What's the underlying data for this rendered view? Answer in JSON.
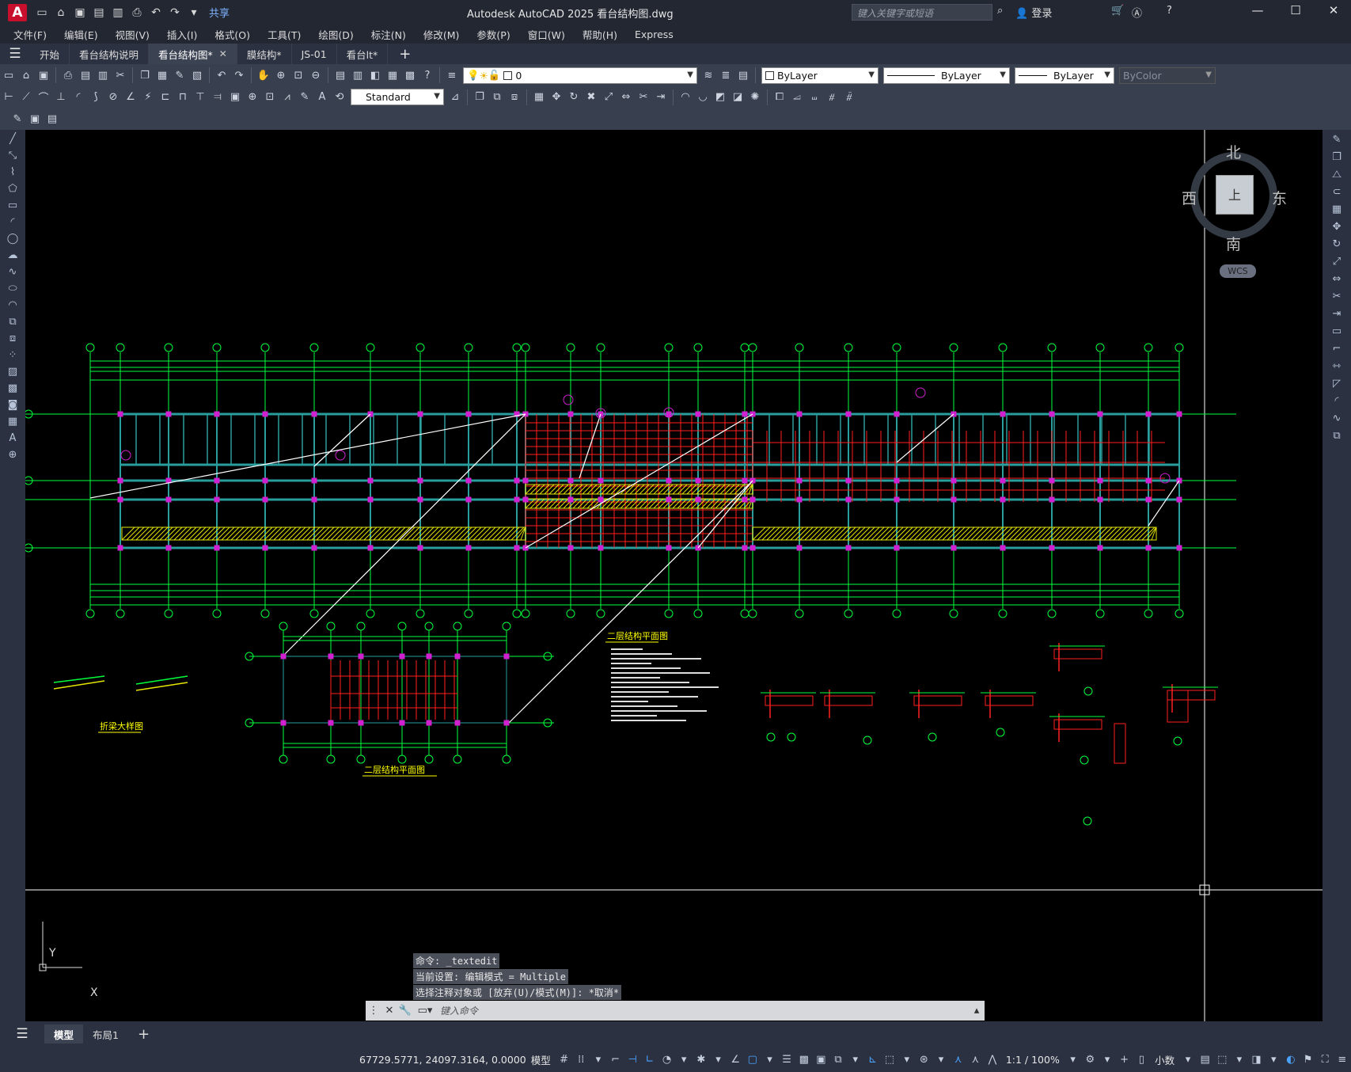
{
  "app": {
    "title": "Autodesk AutoCAD 2025    看台结构图.dwg",
    "icon_letter": "A",
    "share_label": "共享",
    "search_placeholder": "键入关键字或短语",
    "login_label": "登录"
  },
  "menu": [
    "文件(F)",
    "编辑(E)",
    "视图(V)",
    "插入(I)",
    "格式(O)",
    "工具(T)",
    "绘图(D)",
    "标注(N)",
    "修改(M)",
    "参数(P)",
    "窗口(W)",
    "帮助(H)",
    "Express"
  ],
  "tabs": [
    {
      "label": "开始",
      "active": false
    },
    {
      "label": "看台结构说明",
      "active": false
    },
    {
      "label": "看台结构图*",
      "active": true
    },
    {
      "label": "膜结构*",
      "active": false
    },
    {
      "label": "JS-01",
      "active": false
    },
    {
      "label": "看台lt*",
      "active": false
    }
  ],
  "toolbar": {
    "layer_value": "0",
    "color_value": "ByLayer",
    "linetype_value": "ByLayer",
    "lineweight_value": "ByLayer",
    "plotstyle_value": "ByColor",
    "dimstyle_value": "Standard"
  },
  "viewcube": {
    "north": "北",
    "south": "南",
    "west": "西",
    "east": "东",
    "face": "上",
    "wcs": "WCS"
  },
  "ucs": {
    "x": "X",
    "y": "Y"
  },
  "drawing": {
    "plan_title_main": "二层结构平面图",
    "plan_title_detail": "二层结构平面图",
    "node_title": "折梁大样图"
  },
  "command": {
    "history": [
      "命令: _textedit",
      "当前设置: 编辑模式 = Multiple",
      "选择注释对象或 [放弃(U)/模式(M)]: *取消*"
    ],
    "placeholder": "键入命令"
  },
  "layout_tabs": [
    {
      "label": "模型",
      "active": true
    },
    {
      "label": "布局1",
      "active": false
    }
  ],
  "status": {
    "coordinates": "67729.5771, 24097.3164, 0.0000",
    "model_label": "模型",
    "scale": "1:1 / 100%",
    "units": "小数"
  },
  "colors": {
    "grid": "#00ff3c",
    "beam": "#2a9d9d",
    "rebar": "#ff2020",
    "axis_bubble": "#00ff3c",
    "column": "#d020d0",
    "hatch": "#e6e600",
    "leader": "#ffffff",
    "text": "#ffff00"
  }
}
